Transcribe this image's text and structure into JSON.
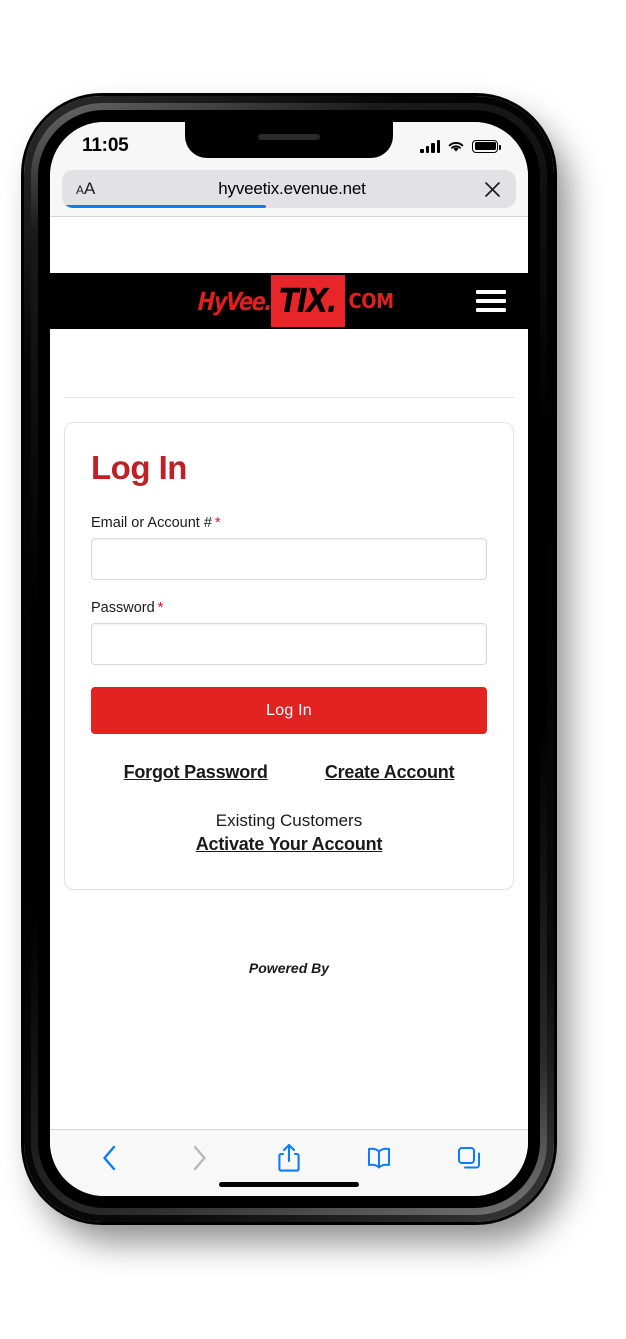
{
  "device": {
    "status_bar": {
      "time": "11:05",
      "signal_icon": "cellular-signal-icon",
      "wifi_icon": "wifi-icon",
      "battery_icon": "battery-full-icon"
    },
    "home_indicator": "home-indicator"
  },
  "browser": {
    "text_size_button": {
      "small_a": "A",
      "big_a": "A"
    },
    "url": "hyveetix.evenue.net",
    "close_label": "✕",
    "loading_progress": 45,
    "toolbar": {
      "back": "back-icon",
      "forward": "forward-icon",
      "share": "share-icon",
      "bookmarks": "bookmarks-icon",
      "tabs": "tabs-icon"
    }
  },
  "site": {
    "logo": {
      "brand": "HyVee.",
      "tix": "TIX.",
      "com": "COM"
    },
    "menu_icon": "hamburger-menu-icon"
  },
  "login": {
    "title": "Log In",
    "fields": [
      {
        "label": "Email or Account #",
        "required_mark": "*",
        "value": "",
        "placeholder": ""
      },
      {
        "label": "Password",
        "required_mark": "*",
        "value": "",
        "placeholder": ""
      }
    ],
    "submit_label": "Log In",
    "forgot_password_label": "Forgot Password",
    "create_account_label": "Create Account",
    "existing_customers_label": "Existing Customers",
    "activate_account_label": "Activate Your Account"
  },
  "footer": {
    "powered_by": "Powered By"
  },
  "colors": {
    "brand_red": "#e32222",
    "title_red": "#bf2026",
    "nav_black": "#000000",
    "safari_blue": "#0a7cff"
  }
}
